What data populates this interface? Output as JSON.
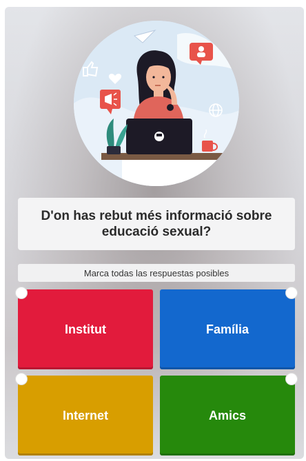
{
  "question": {
    "text": "D'on has rebut més informació sobre educació sexual?"
  },
  "hint": {
    "text": "Marca todas las respuestas posibles"
  },
  "answers": [
    {
      "label": "Institut",
      "color": "#e21b3c"
    },
    {
      "label": "Família",
      "color": "#1368ce"
    },
    {
      "label": "Internet",
      "color": "#d89e00"
    },
    {
      "label": "Amics",
      "color": "#26890c"
    }
  ],
  "illustration": {
    "icons": [
      "paper-plane-icon",
      "thumbs-up-icon",
      "heart-icon",
      "group-chat-icon",
      "megaphone-icon",
      "globe-icon",
      "laptop-icon",
      "coffee-cup-icon",
      "plant-icon"
    ]
  }
}
